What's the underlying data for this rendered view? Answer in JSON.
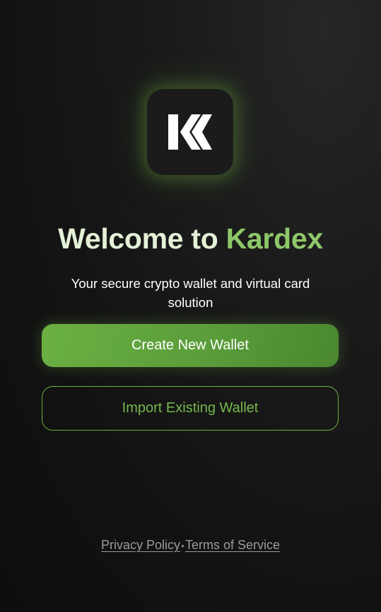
{
  "app": {
    "logo": {
      "icon": "kardex-k-logo-icon",
      "accent": "#6bb043"
    }
  },
  "welcome": {
    "title_part1": "Welcome to",
    "title_part2": "Kardex",
    "subtitle": "Your secure crypto wallet and virtual card solution"
  },
  "actions": {
    "create_label": "Create New Wallet",
    "import_label": "Import Existing Wallet"
  },
  "footer": {
    "privacy_label": "Privacy Policy",
    "separator": "•",
    "terms_label": "Terms of Service"
  },
  "colors": {
    "accent": "#6bb043",
    "title_light": "#e3f1d7",
    "title_accent": "#8ec86a",
    "background": "#141414"
  }
}
